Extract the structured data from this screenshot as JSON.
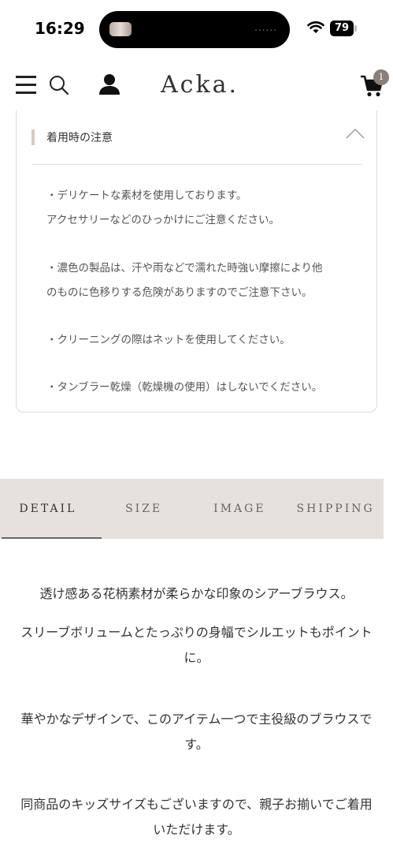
{
  "status_bar": {
    "time": "16:29",
    "island_dots": "......",
    "battery": "79"
  },
  "header": {
    "logo": "Acka.",
    "cart_count": "1",
    "icons": [
      "menu-icon",
      "search-icon",
      "user-icon",
      "cart-icon"
    ]
  },
  "care": {
    "title": "着用時の注意",
    "lines": [
      "・デリケートな素材を使用しております。",
      "アクセサリーなどのひっかけにご注意ください。",
      "・濃色の製品は、汗や雨などで濡れた時強い摩擦により他",
      "のものに色移りする危険がありますのでご注意下さい。",
      "・クリーニングの際はネットを使用してください。",
      "・タンブラー乾燥（乾燥機の使用）はしないでください。"
    ]
  },
  "tabs": {
    "items": [
      "DETAIL",
      "SIZE",
      "IMAGE",
      "SHIPPING"
    ],
    "active": "DETAIL"
  },
  "description": {
    "p1": "透け感ある花柄素材が柔らかな印象のシアーブラウス。",
    "p2": "スリーブボリュームとたっぷりの身幅でシルエットもポイントに。",
    "p3": "華やかなデザインで、このアイテム一つで主役級のブラウスです。",
    "p4": "同商品のキッズサイズもございますので、親子お揃いでご着用いただけます。"
  },
  "colors": {
    "tab_bg": "#e6e1dd",
    "badge": "#8a7f79",
    "accent_bar": "#d5ccc6"
  }
}
